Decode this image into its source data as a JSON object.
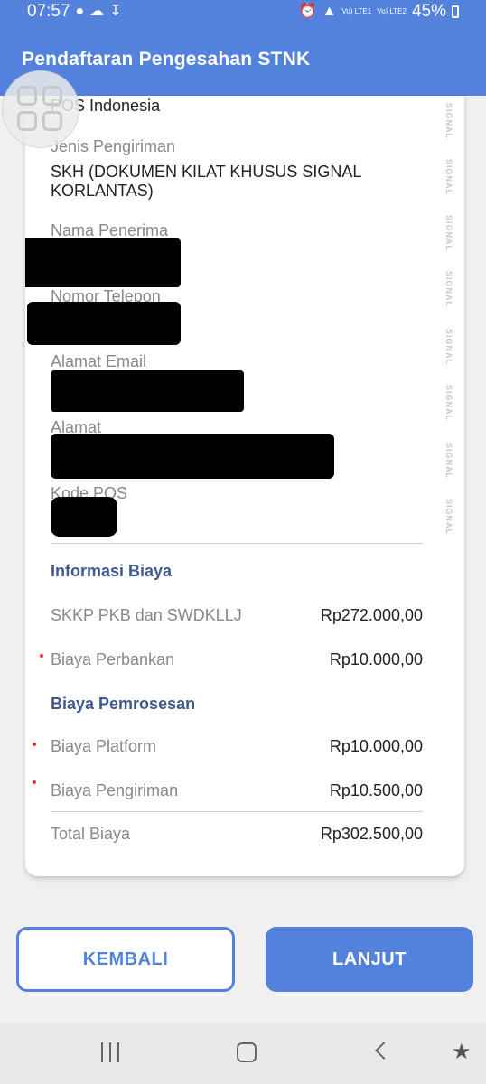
{
  "status_bar": {
    "time": "07:57",
    "left_icons": [
      "whatsapp-icon",
      "cloud-icon",
      "download-icon"
    ],
    "right_icons": [
      "alarm-icon",
      "wifi-icon",
      "signal-lte1-icon",
      "signal-lte2-icon"
    ],
    "lte1": "Vo) LTE1",
    "lte2": "Vo) LTE2",
    "battery": "45%"
  },
  "app_bar": {
    "title": "Pendaftaran Pengesahan STNK"
  },
  "watermark": "SIGNAL",
  "details": {
    "courier_value": "POS Indonesia",
    "shipping_type_label": "Jenis Pengiriman",
    "shipping_type_value": "SKH (DOKUMEN KILAT KHUSUS SIGNAL KORLANTAS)",
    "recipient_label": "Nama Penerima",
    "phone_label": "Nomor Telepon",
    "email_label": "Alamat Email",
    "address_label": "Alamat",
    "postal_label": "Kode POS"
  },
  "biaya": {
    "section_title": "Informasi Biaya",
    "items": [
      {
        "label": "SKKP PKB dan SWDKLLJ",
        "amount": "Rp272.000,00"
      },
      {
        "label": "Biaya Perbankan",
        "amount": "Rp10.000,00"
      }
    ]
  },
  "pemrosesan": {
    "section_title": "Biaya Pemrosesan",
    "items": [
      {
        "label": "Biaya Platform",
        "amount": "Rp10.000,00"
      },
      {
        "label": "Biaya Pengiriman",
        "amount": "Rp10.500,00"
      }
    ]
  },
  "total": {
    "label": "Total Biaya",
    "amount": "Rp302.500,00"
  },
  "buttons": {
    "back": "KEMBALI",
    "next": "LANJUT"
  },
  "colors": {
    "primary": "#5282dc",
    "section_title": "#3d5a8f",
    "required_dot": "#e53935"
  }
}
